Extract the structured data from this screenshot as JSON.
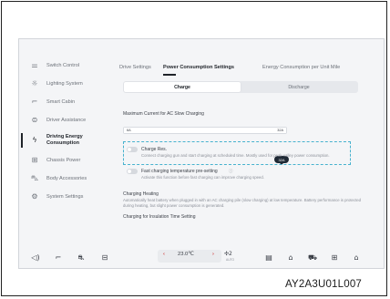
{
  "sidebar": {
    "items": [
      {
        "label": "Switch Control",
        "icon": "switch-control-icon"
      },
      {
        "label": "Lighting System",
        "icon": "light-icon"
      },
      {
        "label": "Smart Cabin",
        "icon": "smart-cabin-icon"
      },
      {
        "label": "Driver Assistance",
        "icon": "driver-assistance-icon"
      },
      {
        "label": "Driving Energy Consumption",
        "icon": "energy-icon",
        "active": true
      },
      {
        "label": "Chassis Power",
        "icon": "chassis-icon"
      },
      {
        "label": "Body Accessories",
        "icon": "car-body-icon"
      },
      {
        "label": "System Settings",
        "icon": "settings-icon"
      }
    ]
  },
  "tabs": [
    {
      "label": "Drive Settings"
    },
    {
      "label": "Power Consumption Settings",
      "active": true
    },
    {
      "label": "Energy Consumption per Unit Mile"
    }
  ],
  "segment": {
    "charge": "Charge",
    "discharge": "Discharge"
  },
  "max_current": {
    "title": "Maximum Current for AC Slow Charging",
    "min_label": "6A",
    "max_label": "32A",
    "value_label": "32A",
    "value_fraction": 1.0
  },
  "charge_res": {
    "title": "Charge Res.",
    "description": "Connect charging gun and start charging at scheduled time. Mostly used for peak-valley power consumption.",
    "enabled": false
  },
  "fast_preheat": {
    "title": "Fast charging temperature pre-setting",
    "description": "Activate this function before fast charging can improve charging speed.",
    "enabled": false
  },
  "charging_heating": {
    "title": "Charging Heating",
    "description": "Automatically heat battery when plugged in with an AC charging pile (slow charging) at low temperature. Battery performance is protected during heating, but slight power consumption is generated."
  },
  "insulation": {
    "title": "Charging for Insulation Time Setting"
  },
  "bottom_bar": {
    "temperature": "23.0℃",
    "fan_label": "2",
    "fan_sub": "AUTO"
  },
  "caption": "AY2A3U01L007",
  "colors": {
    "highlight_border": "#47b2ce",
    "bubble": "#1f2935",
    "temp_arrow": "#d03a3a"
  }
}
